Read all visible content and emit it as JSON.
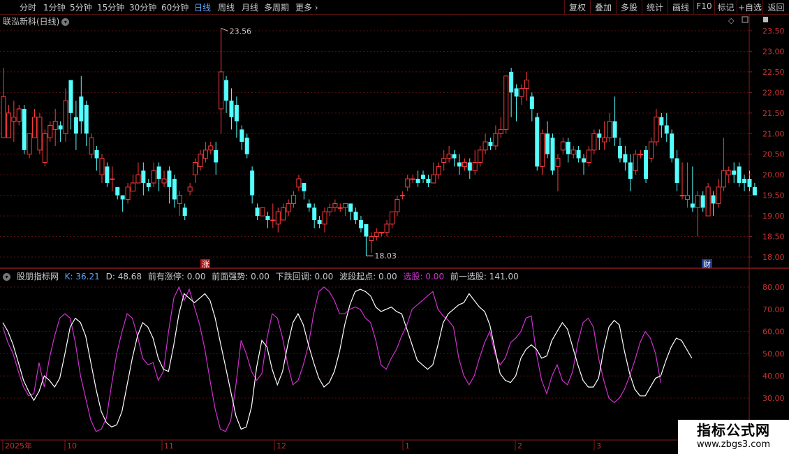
{
  "toolbar": {
    "periods": [
      "分时",
      "1分钟",
      "5分钟",
      "15分钟",
      "30分钟",
      "60分钟",
      "日线",
      "周线",
      "月线",
      "多周期",
      "更多"
    ],
    "active_period": "日线",
    "more_arrow": "›",
    "right_buttons": [
      "复权",
      "叠加",
      "多股",
      "统计",
      "画线",
      "F10",
      "标记",
      "+自选",
      "返回"
    ]
  },
  "main": {
    "title": "联泓新科(日线)",
    "price_axis": [
      "23.50",
      "23.00",
      "22.50",
      "22.00",
      "21.50",
      "21.00",
      "20.50",
      "20.00",
      "19.50",
      "19.00",
      "18.50",
      "18.00"
    ],
    "high_label": "23.56",
    "low_label": "18.03",
    "marker_zhang": "涨",
    "marker_cai": "财"
  },
  "indicator": {
    "name": "股朋指标网",
    "k_label": "K: 36.21",
    "d_label": "D: 48.68",
    "fields": [
      "前有涨停: 0.00",
      "前面强势: 0.00",
      "下跌回调: 0.00",
      "波段起点: 0.00"
    ],
    "xuangu_label": "选股: 0.00",
    "prev_xuangu": "前一选股: 141.00",
    "axis": [
      "80.00",
      "70.00",
      "60.00",
      "50.00",
      "40.00",
      "30.00"
    ]
  },
  "time_axis": [
    "2025年",
    "10",
    "11",
    "12",
    "1",
    "2",
    "3"
  ],
  "watermark": {
    "line1": "指标公式网",
    "line2": "www.zbgs3.com"
  },
  "colors": {
    "up": "#ff3c3c",
    "down": "#54ffff",
    "k_line": "#ffffff",
    "d_line": "#d030d0",
    "grid": "#5a1010",
    "accent": "#5aa7ff"
  },
  "chart_data": {
    "type": "candlestick",
    "ylim": [
      17.95,
      23.65
    ],
    "candles": [
      [
        20.9,
        21.9,
        21.4,
        22.6
      ],
      [
        20.9,
        21.5,
        21.0,
        21.7
      ],
      [
        21.3,
        21.4,
        20.8,
        21.8
      ],
      [
        21.3,
        21.6,
        21.2,
        21.7
      ],
      [
        21.6,
        20.6,
        20.5,
        21.7
      ],
      [
        20.5,
        21.0,
        20.4,
        21.0
      ],
      [
        20.9,
        21.4,
        20.9,
        21.6
      ],
      [
        20.6,
        21.4,
        20.5,
        21.5
      ],
      [
        20.3,
        21.0,
        20.2,
        21.1
      ],
      [
        20.9,
        21.2,
        20.8,
        21.3
      ],
      [
        21.1,
        21.3,
        20.7,
        21.6
      ],
      [
        21.2,
        21.1,
        20.8,
        21.3
      ],
      [
        21.0,
        21.8,
        20.8,
        22.1
      ],
      [
        22.3,
        21.5,
        21.1,
        22.3
      ],
      [
        21.4,
        21.0,
        20.6,
        21.8
      ],
      [
        21.9,
        21.3,
        21.0,
        22.4
      ],
      [
        21.7,
        21.0,
        20.7,
        21.8
      ],
      [
        20.5,
        20.9,
        20.4,
        21.0
      ],
      [
        20.6,
        20.4,
        20.1,
        20.7
      ],
      [
        20.0,
        20.4,
        19.8,
        20.5
      ],
      [
        20.2,
        19.8,
        19.7,
        20.3
      ],
      [
        19.9,
        19.9,
        19.6,
        20.2
      ],
      [
        19.7,
        19.5,
        19.4,
        19.7
      ],
      [
        19.5,
        19.4,
        19.1,
        19.5
      ],
      [
        19.4,
        19.7,
        19.3,
        19.8
      ],
      [
        19.6,
        19.8,
        19.6,
        20.0
      ],
      [
        19.8,
        20.0,
        19.8,
        20.3
      ],
      [
        20.1,
        19.8,
        19.5,
        20.3
      ],
      [
        19.8,
        19.7,
        19.6,
        19.9
      ],
      [
        19.8,
        20.1,
        19.7,
        20.3
      ],
      [
        20.2,
        19.9,
        19.6,
        20.3
      ],
      [
        19.8,
        19.9,
        19.7,
        20.1
      ],
      [
        20.1,
        19.7,
        19.3,
        20.2
      ],
      [
        19.9,
        19.4,
        19.2,
        20.0
      ],
      [
        19.3,
        19.5,
        19.0,
        19.6
      ],
      [
        19.2,
        19.0,
        18.9,
        19.3
      ],
      [
        19.6,
        19.7,
        19.5,
        19.8
      ],
      [
        20.0,
        20.3,
        19.8,
        20.4
      ],
      [
        20.2,
        20.5,
        20.1,
        20.6
      ],
      [
        20.4,
        20.6,
        20.3,
        20.8
      ],
      [
        20.6,
        20.7,
        20.5,
        20.8
      ],
      [
        20.6,
        20.3,
        20.0,
        20.8
      ],
      [
        21.6,
        22.5,
        21.0,
        23.56
      ],
      [
        22.3,
        21.8,
        21.5,
        22.4
      ],
      [
        21.8,
        21.4,
        21.1,
        22.1
      ],
      [
        21.7,
        21.3,
        20.9,
        21.9
      ],
      [
        21.1,
        20.8,
        20.6,
        21.2
      ],
      [
        20.9,
        20.5,
        20.4,
        21.0
      ],
      [
        20.1,
        19.5,
        19.3,
        20.2
      ],
      [
        19.2,
        19.0,
        18.9,
        19.3
      ],
      [
        19.0,
        19.2,
        19.0,
        19.2
      ],
      [
        19.0,
        18.9,
        18.7,
        19.1
      ],
      [
        18.9,
        18.9,
        18.7,
        19.3
      ],
      [
        18.8,
        19.1,
        18.6,
        19.2
      ],
      [
        18.9,
        19.2,
        18.9,
        19.3
      ],
      [
        19.1,
        19.3,
        19.0,
        19.4
      ],
      [
        19.3,
        19.5,
        19.2,
        19.6
      ],
      [
        19.7,
        19.9,
        19.6,
        20.0
      ],
      [
        19.8,
        19.6,
        19.4,
        19.8
      ],
      [
        19.3,
        19.2,
        19.1,
        19.4
      ],
      [
        19.2,
        18.9,
        18.7,
        19.3
      ],
      [
        18.9,
        18.8,
        18.7,
        19.0
      ],
      [
        18.8,
        19.1,
        18.6,
        19.2
      ],
      [
        19.1,
        19.2,
        19.0,
        19.3
      ],
      [
        19.2,
        19.3,
        19.1,
        19.4
      ],
      [
        19.2,
        19.2,
        19.1,
        19.3
      ],
      [
        19.2,
        19.3,
        19.0,
        19.3
      ],
      [
        19.3,
        19.1,
        18.9,
        19.3
      ],
      [
        19.1,
        18.9,
        18.8,
        19.2
      ],
      [
        18.9,
        18.7,
        18.6,
        19.0
      ],
      [
        18.8,
        18.5,
        18.03,
        18.8
      ],
      [
        18.4,
        18.5,
        18.1,
        18.6
      ],
      [
        18.5,
        18.6,
        18.4,
        18.7
      ],
      [
        18.6,
        18.6,
        18.5,
        18.6
      ],
      [
        18.6,
        18.8,
        18.5,
        18.9
      ],
      [
        18.8,
        19.1,
        18.7,
        19.1
      ],
      [
        19.1,
        19.4,
        19.0,
        19.5
      ],
      [
        19.5,
        19.5,
        19.4,
        19.6
      ],
      [
        19.7,
        19.9,
        19.6,
        20.0
      ],
      [
        19.9,
        19.9,
        19.8,
        20.0
      ],
      [
        19.9,
        19.8,
        19.7,
        20.1
      ],
      [
        20.0,
        19.9,
        19.8,
        20.1
      ],
      [
        19.9,
        19.8,
        19.7,
        20.0
      ],
      [
        19.8,
        20.0,
        19.8,
        20.3
      ],
      [
        20.0,
        20.2,
        19.9,
        20.3
      ],
      [
        20.3,
        20.4,
        20.1,
        20.6
      ],
      [
        20.4,
        20.5,
        20.3,
        20.7
      ],
      [
        20.5,
        20.4,
        20.2,
        20.6
      ],
      [
        20.3,
        20.2,
        20.0,
        20.5
      ],
      [
        20.2,
        20.3,
        20.1,
        20.4
      ],
      [
        20.3,
        20.1,
        19.9,
        20.4
      ],
      [
        20.1,
        20.3,
        20.0,
        20.6
      ],
      [
        20.3,
        20.6,
        20.2,
        20.7
      ],
      [
        20.6,
        20.8,
        20.5,
        21.0
      ],
      [
        20.8,
        20.7,
        20.6,
        20.9
      ],
      [
        20.7,
        21.0,
        20.6,
        21.2
      ],
      [
        21.0,
        21.1,
        20.9,
        21.4
      ],
      [
        21.1,
        22.4,
        21.0,
        22.4
      ],
      [
        22.5,
        22.0,
        21.4,
        22.6
      ],
      [
        22.1,
        21.9,
        21.3,
        22.2
      ],
      [
        21.9,
        22.1,
        21.7,
        22.2
      ],
      [
        22.1,
        22.3,
        21.8,
        22.5
      ],
      [
        21.9,
        21.6,
        21.3,
        22.0
      ],
      [
        21.4,
        20.2,
        20.1,
        21.5
      ],
      [
        20.2,
        21.0,
        20.0,
        21.1
      ],
      [
        21.0,
        20.5,
        20.4,
        21.3
      ],
      [
        20.9,
        20.1,
        20.0,
        21.0
      ],
      [
        20.2,
        20.4,
        19.6,
        20.5
      ],
      [
        20.6,
        20.8,
        20.5,
        20.9
      ],
      [
        20.8,
        20.5,
        20.3,
        20.9
      ],
      [
        20.5,
        20.6,
        20.4,
        20.7
      ],
      [
        20.6,
        20.4,
        20.3,
        20.7
      ],
      [
        20.4,
        20.3,
        20.0,
        20.5
      ],
      [
        20.3,
        20.6,
        20.2,
        20.7
      ],
      [
        20.6,
        21.0,
        20.5,
        21.1
      ],
      [
        21.0,
        20.9,
        20.6,
        21.1
      ],
      [
        20.8,
        20.9,
        20.6,
        21.3
      ],
      [
        20.9,
        21.3,
        20.8,
        21.5
      ],
      [
        21.3,
        20.9,
        20.7,
        21.9
      ],
      [
        20.7,
        20.4,
        20.3,
        20.9
      ],
      [
        20.5,
        20.3,
        20.1,
        20.7
      ],
      [
        20.3,
        19.9,
        19.6,
        20.5
      ],
      [
        20.1,
        20.5,
        20.0,
        20.6
      ],
      [
        20.5,
        20.5,
        20.4,
        20.6
      ],
      [
        20.6,
        19.9,
        19.8,
        20.7
      ],
      [
        20.4,
        20.8,
        20.3,
        20.9
      ],
      [
        20.8,
        21.4,
        20.7,
        21.6
      ],
      [
        21.4,
        21.2,
        20.9,
        21.5
      ],
      [
        21.2,
        21.0,
        20.8,
        21.5
      ],
      [
        21.0,
        20.4,
        20.3,
        21.1
      ],
      [
        20.4,
        19.8,
        19.6,
        20.6
      ],
      [
        19.5,
        19.5,
        19.4,
        20.3
      ],
      [
        19.4,
        19.5,
        19.2,
        20.3
      ],
      [
        19.3,
        19.2,
        19.1,
        20.2
      ],
      [
        19.2,
        19.5,
        18.5,
        19.6
      ],
      [
        19.5,
        19.2,
        19.1,
        19.6
      ],
      [
        19.0,
        19.7,
        19.0,
        19.8
      ],
      [
        19.5,
        19.3,
        19.0,
        19.6
      ],
      [
        19.3,
        19.7,
        19.2,
        19.9
      ],
      [
        19.7,
        20.1,
        19.6,
        20.9
      ],
      [
        20.0,
        20.1,
        19.8,
        20.2
      ],
      [
        20.1,
        20.0,
        19.8,
        20.3
      ],
      [
        20.2,
        19.8,
        19.7,
        20.3
      ],
      [
        19.9,
        19.8,
        19.6,
        20.0
      ],
      [
        19.9,
        19.7,
        19.6,
        20.1
      ],
      [
        19.7,
        19.5,
        19.5,
        19.8
      ]
    ],
    "k": [
      64,
      60,
      54,
      46,
      38,
      33,
      29,
      33,
      40,
      38,
      35,
      39,
      50,
      62,
      66,
      64,
      58,
      46,
      34,
      24,
      19,
      17,
      18,
      24,
      36,
      48,
      58,
      64,
      62,
      57,
      48,
      43,
      42,
      54,
      68,
      77,
      75,
      73,
      75,
      77,
      74,
      66,
      55,
      44,
      33,
      22,
      16,
      17,
      26,
      44,
      56,
      53,
      43,
      36,
      42,
      54,
      64,
      68,
      63,
      54,
      46,
      39,
      35,
      37,
      42,
      51,
      63,
      72,
      78,
      79,
      78,
      76,
      71,
      69,
      70,
      71,
      69,
      68,
      61,
      54,
      47,
      45,
      43,
      45,
      54,
      64,
      68,
      70,
      72,
      73,
      77,
      74,
      71,
      69,
      63,
      52,
      41,
      38,
      37,
      40,
      48,
      52,
      54,
      52,
      48,
      49,
      56,
      60,
      64,
      61,
      53,
      45,
      38,
      35,
      35,
      39,
      52,
      62,
      65,
      63,
      51,
      41,
      34,
      31,
      31,
      35,
      39,
      40,
      47,
      53,
      57,
      56,
      52,
      48
    ],
    "d": [
      62,
      55,
      50,
      42,
      35,
      31,
      32,
      46,
      35,
      48,
      58,
      66,
      68,
      66,
      55,
      40,
      30,
      20,
      15,
      16,
      21,
      36,
      50,
      60,
      68,
      66,
      58,
      48,
      45,
      46,
      38,
      42,
      60,
      75,
      80,
      74,
      79,
      71,
      63,
      52,
      38,
      25,
      16,
      15,
      20,
      36,
      56,
      50,
      42,
      38,
      41,
      57,
      68,
      66,
      57,
      45,
      36,
      38,
      45,
      54,
      68,
      78,
      80,
      78,
      74,
      68,
      68,
      70,
      71,
      70,
      66,
      64,
      56,
      45,
      43,
      48,
      52,
      58,
      63,
      70,
      72,
      74,
      76,
      78,
      70,
      67,
      65,
      62,
      48,
      40,
      36,
      40,
      48,
      55,
      60,
      50,
      45,
      48,
      55,
      57,
      60,
      66,
      67,
      50,
      38,
      32,
      40,
      45,
      38,
      36,
      42,
      55,
      64,
      66,
      62,
      48,
      38,
      30,
      28,
      30,
      34,
      40,
      47,
      55,
      60,
      57,
      50,
      37
    ]
  }
}
